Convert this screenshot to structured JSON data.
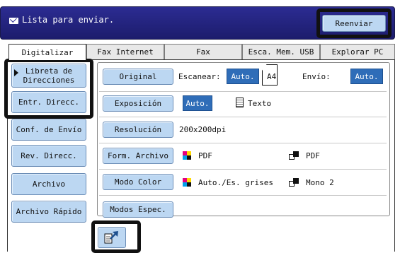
{
  "status": {
    "message": "Lista para enviar.",
    "resend_label": "Reenviar"
  },
  "tabs": [
    {
      "label": "Digitalizar"
    },
    {
      "label": "Fax Internet"
    },
    {
      "label": "Fax"
    },
    {
      "label": "Esca. Mem. USB"
    },
    {
      "label": "Explorar PC"
    }
  ],
  "sidebar": [
    {
      "label": "Libreta de Direcciones"
    },
    {
      "label": "Entr. Direcc."
    },
    {
      "label": "Conf. de Envío"
    },
    {
      "label": "Rev. Direcc."
    },
    {
      "label": "Archivo"
    },
    {
      "label": "Archivo Rápido"
    }
  ],
  "settings": {
    "original": {
      "label": "Original",
      "scan_label": "Escanear:",
      "scan_value": "Auto.",
      "paper": "A4",
      "send_label": "Envío:",
      "send_value": "Auto."
    },
    "exposure": {
      "label": "Exposición",
      "value": "Auto.",
      "mode": "Texto"
    },
    "resolution": {
      "label": "Resolución",
      "value": "200x200dpi"
    },
    "file_format": {
      "label": "Form. Archivo",
      "color_value": "PDF",
      "mono_value": "PDF"
    },
    "color_mode": {
      "label": "Modo Color",
      "color_value": "Auto./Es. grises",
      "mono_value": "Mono 2"
    },
    "special": {
      "label": "Modos Espec."
    }
  },
  "colors": {
    "accent": "#2f6db8",
    "button": "#bcd7f2",
    "status_bar": "#1c1c6c"
  }
}
